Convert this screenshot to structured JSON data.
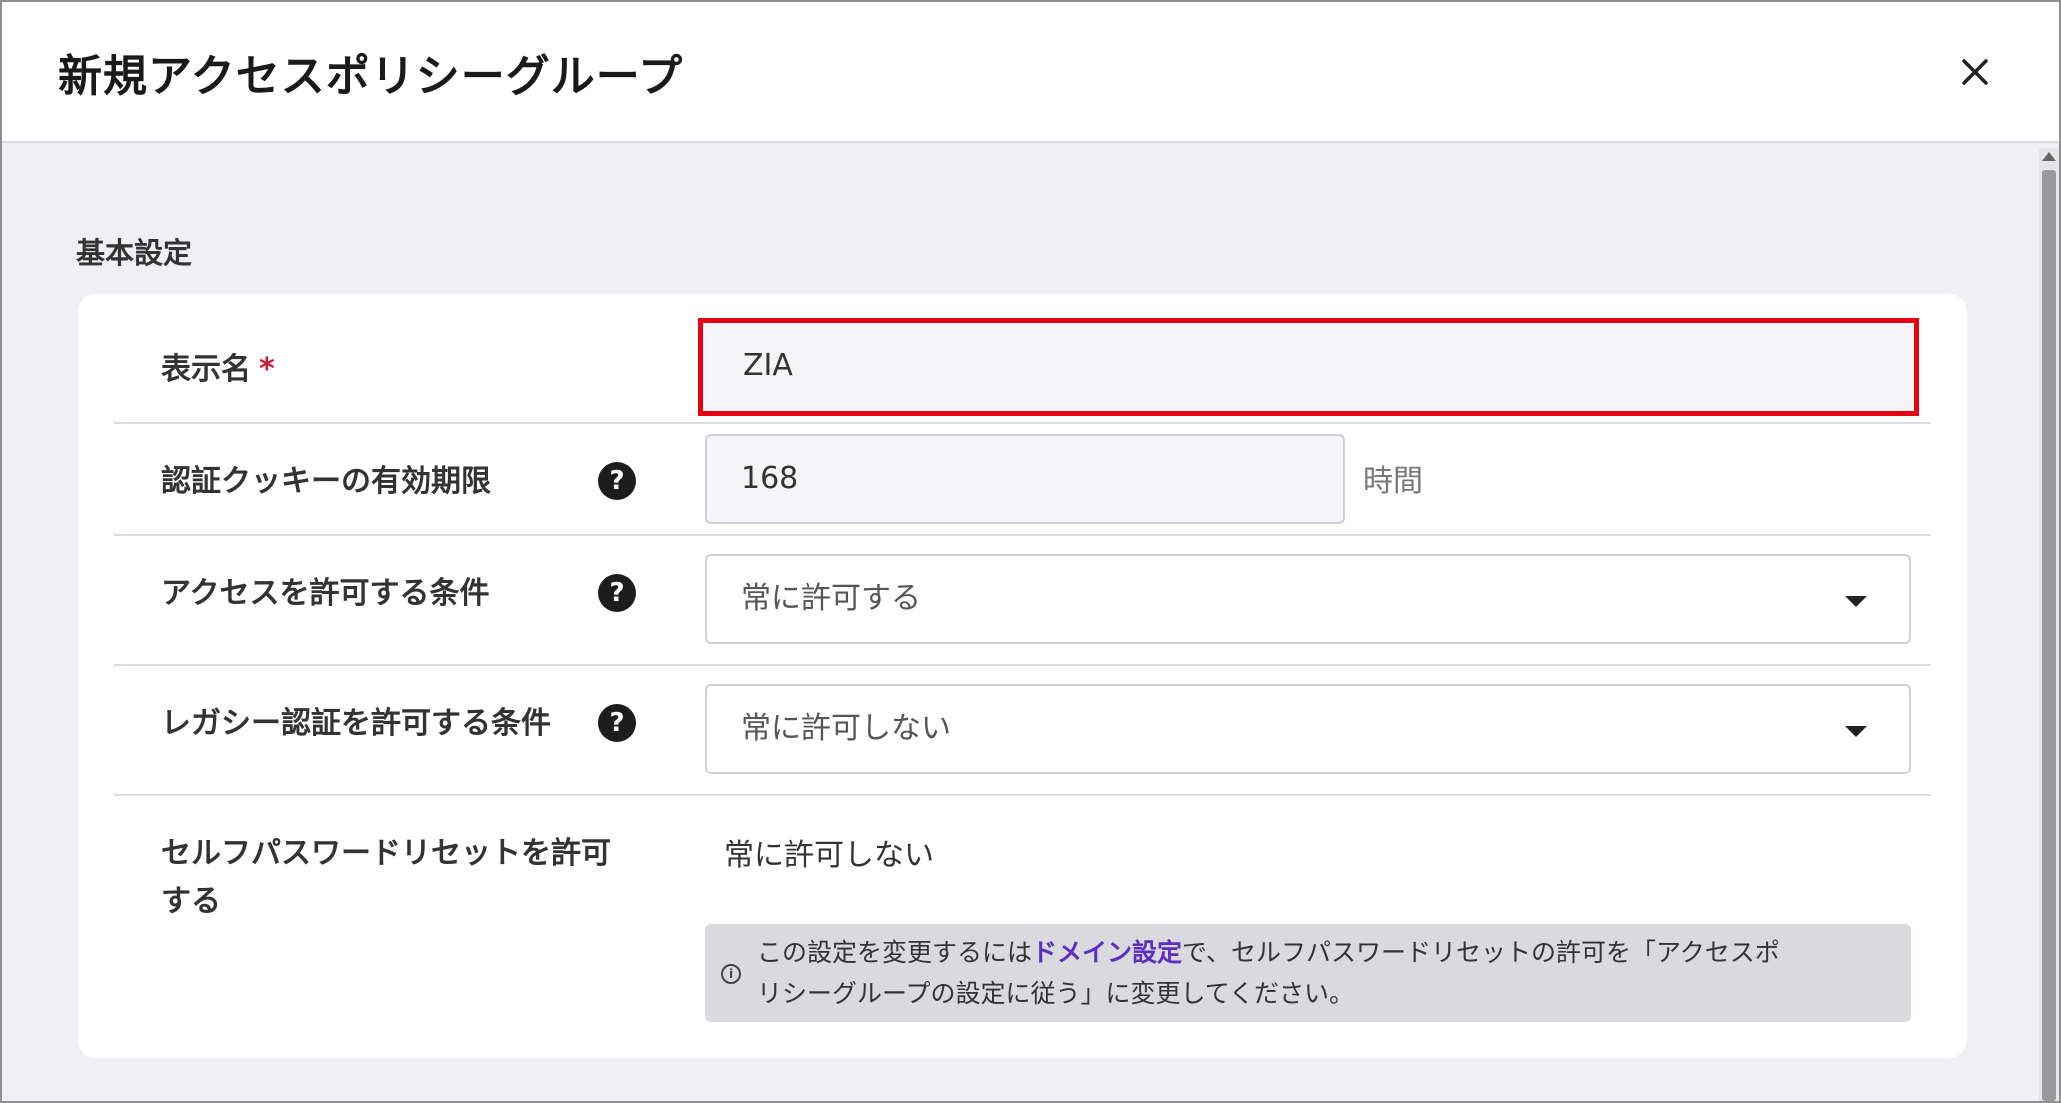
{
  "dialog": {
    "title": "新規アクセスポリシーグループ",
    "close_icon": "close-icon"
  },
  "section": {
    "label": "基本設定"
  },
  "fields": {
    "display_name": {
      "label": "表示名",
      "required_mark": "*",
      "value": "ZIA"
    },
    "cookie_expiry": {
      "label": "認証クッキーの有効期限",
      "help_icon": "question-circle-icon",
      "help_glyph": "?",
      "value": "168",
      "unit": "時間"
    },
    "access_condition": {
      "label": "アクセスを許可する条件",
      "help_icon": "question-circle-icon",
      "help_glyph": "?",
      "selected": "常に許可する"
    },
    "legacy_auth_condition": {
      "label": "レガシー認証を許可する条件",
      "help_icon": "question-circle-icon",
      "help_glyph": "?",
      "selected": "常に許可しない"
    },
    "self_password_reset": {
      "label_line1": "セルフパスワードリセットを許可",
      "label_line2": "する",
      "value": "常に許可しない",
      "note_prefix": "この設定を変更するには",
      "note_link": "ドメイン設定",
      "note_line1_suffix": "で、セルフパスワードリセットの許可を「アクセスポ",
      "note_line2": "リシーグループの設定に従う」に変更してください。",
      "info_icon": "info-icon",
      "info_glyph": "i"
    }
  },
  "colors": {
    "highlight_border": "#e60012",
    "link": "#5a2fc2",
    "required": "#d0193a"
  }
}
